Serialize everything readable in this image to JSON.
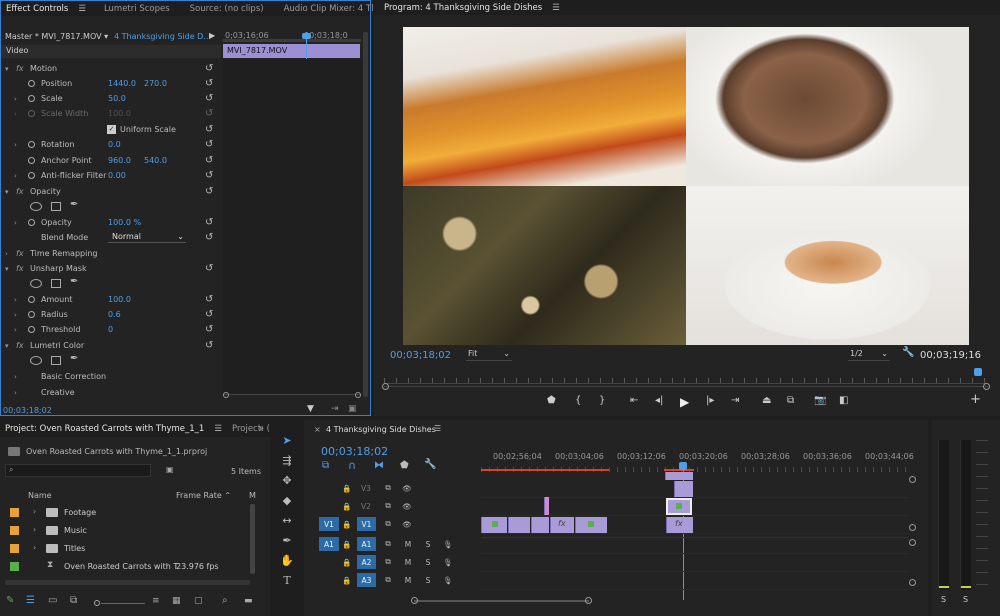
{
  "effect_controls": {
    "tabs": [
      "Effect Controls",
      "Lumetri Scopes",
      "Source: (no clips)",
      "Audio Clip Mixer: 4 Tl"
    ],
    "master": "Master * MVI_7817.MOV",
    "sequence_link": "4 Thanksgiving Side D...",
    "ruler_times": [
      "0;03;16;06",
      "00;03;18;0"
    ],
    "clip_name": "MVI_7817.MOV",
    "section": "Video",
    "motion": {
      "label": "Motion",
      "position_label": "Position",
      "position_x": "1440.0",
      "position_y": "270.0",
      "scale_label": "Scale",
      "scale": "50.0",
      "scale_width_label": "Scale Width",
      "scale_width": "100.0",
      "uniform_label": "Uniform Scale",
      "rotation_label": "Rotation",
      "rotation": "0.0",
      "anchor_label": "Anchor Point",
      "anchor_x": "960.0",
      "anchor_y": "540.0",
      "antiflicker_label": "Anti-flicker Filter",
      "antiflicker": "0.00"
    },
    "opacity": {
      "label": "Opacity",
      "opacity_label": "Opacity",
      "opacity": "100.0 %",
      "blend_label": "Blend Mode",
      "blend": "Normal"
    },
    "time_remap": "Time Remapping",
    "unsharp": {
      "label": "Unsharp Mask",
      "amount_label": "Amount",
      "amount": "100.0",
      "radius_label": "Radius",
      "radius": "0.6",
      "threshold_label": "Threshold",
      "threshold": "0"
    },
    "lumetri": {
      "label": "Lumetri Color",
      "basic": "Basic Correction",
      "creative": "Creative"
    },
    "timecode": "00;03;18;02"
  },
  "program": {
    "title": "Program: 4 Thanksgiving Side Dishes",
    "timecode": "00;03;18;02",
    "fit": "Fit",
    "resolution": "1/2",
    "duration": "00;03;19;16"
  },
  "project": {
    "tabs": [
      "Project: Oven Roasted Carrots with Thyme_1_1",
      "Project: ("
    ],
    "file": "Oven Roasted Carrots with Thyme_1_1.prproj",
    "items_count": "5 Items",
    "col_name": "Name",
    "col_fps": "Frame Rate",
    "col_m": "M",
    "items": [
      {
        "name": "Footage",
        "color": "#e8a23a"
      },
      {
        "name": "Music",
        "color": "#e8a23a"
      },
      {
        "name": "Titles",
        "color": "#e8a23a"
      },
      {
        "name": "Oven Roasted Carrots with T",
        "fps": "23.976 fps",
        "color": "#5bb04e"
      }
    ]
  },
  "timeline": {
    "title": "4 Thanksgiving Side Dishes",
    "timecode": "00;03;18;02",
    "ruler": [
      "00;02;56;04",
      "00;03;04;06",
      "00;03;12;06",
      "00;03;20;06",
      "00;03;28;06",
      "00;03;36;06",
      "00;03;44;06"
    ],
    "video_tracks": [
      "V3",
      "V2",
      "V1"
    ],
    "audio_tracks": [
      "A1",
      "A2",
      "A3"
    ],
    "src_v": "V1",
    "src_a": "A1",
    "mute": "M",
    "solo": "S",
    "fx": "fx"
  },
  "meters": {
    "left": "S",
    "right": "S"
  }
}
